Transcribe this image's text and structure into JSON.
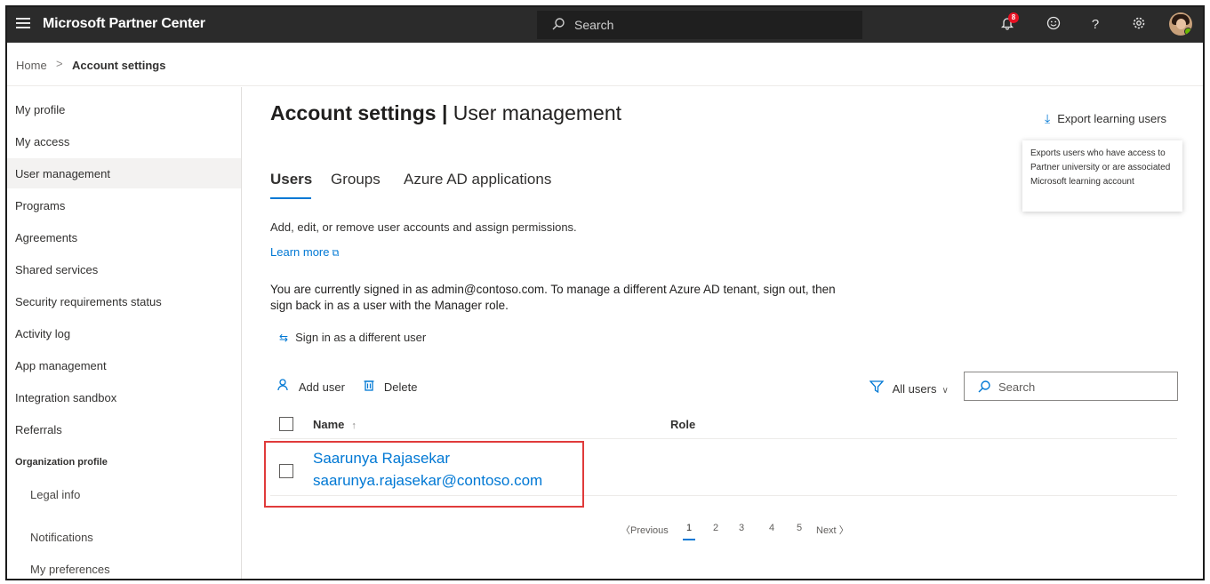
{
  "header": {
    "app_title": "Microsoft Partner Center",
    "search_placeholder": "Search",
    "notification_count": "8"
  },
  "breadcrumb": {
    "home": "Home",
    "separator": ">",
    "current": "Account settings"
  },
  "sidebar": {
    "items": [
      {
        "label": "My profile"
      },
      {
        "label": "My access"
      },
      {
        "label": "User management",
        "selected": true
      },
      {
        "label": "Programs"
      },
      {
        "label": "Agreements"
      },
      {
        "label": "Shared services"
      },
      {
        "label": "Security requirements status"
      },
      {
        "label": "Activity log"
      },
      {
        "label": "App management"
      },
      {
        "label": "Integration sandbox"
      },
      {
        "label": "Referrals"
      }
    ],
    "section_heading": "Organization profile",
    "sub_items": [
      {
        "label": "Legal info"
      },
      {
        "label": "Notifications"
      },
      {
        "label": "My preferences"
      }
    ]
  },
  "main": {
    "title_bold": "Account settings",
    "title_sep": " | ",
    "title_rest": "User management",
    "export_label": "Export learning users",
    "export_tooltip": "Exports users who have access to Partner university or are associated Microsoft learning account",
    "tabs": [
      {
        "label": "Users",
        "active": true
      },
      {
        "label": "Groups"
      },
      {
        "label": "Azure AD applications"
      }
    ],
    "description": "Add, edit, or remove user accounts and assign permissions.",
    "learn_more": "Learn more",
    "signed_in_text": "You are currently signed in as  admin@contoso.com. To manage a different Azure AD tenant, sign out, then sign back in as a user with the Manager role.",
    "sign_in_different": "Sign in as a different user",
    "toolbar": {
      "add_user": "Add user",
      "delete": "Delete",
      "filter": "All users",
      "search_placeholder": "Search"
    },
    "table": {
      "columns": [
        "Name",
        "Role"
      ],
      "rows": [
        {
          "name": "Saarunya Rajasekar",
          "email": "saarunya.rajasekar@contoso.com",
          "role": ""
        }
      ]
    },
    "pagination": {
      "previous": "Previous",
      "pages": [
        "1",
        "2",
        "3",
        "4",
        "5"
      ],
      "current": "1",
      "next": "Next"
    }
  },
  "colors": {
    "accent": "#0078d4",
    "topbar": "#2b2b2b",
    "highlight_border": "#e03b3b",
    "notification_badge": "#e81123"
  }
}
